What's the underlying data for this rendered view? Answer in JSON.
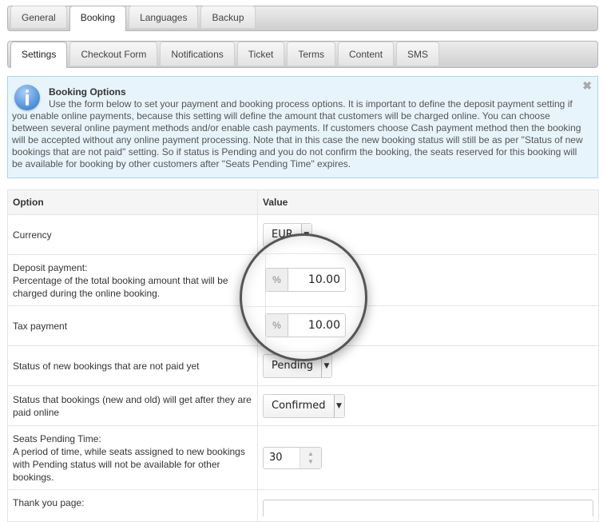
{
  "top_tabs": [
    {
      "label": "General",
      "active": false
    },
    {
      "label": "Booking",
      "active": true
    },
    {
      "label": "Languages",
      "active": false
    },
    {
      "label": "Backup",
      "active": false
    }
  ],
  "sub_tabs": [
    {
      "label": "Settings",
      "active": true
    },
    {
      "label": "Checkout Form",
      "active": false
    },
    {
      "label": "Notifications",
      "active": false
    },
    {
      "label": "Ticket",
      "active": false
    },
    {
      "label": "Terms",
      "active": false
    },
    {
      "label": "Content",
      "active": false
    },
    {
      "label": "SMS",
      "active": false
    }
  ],
  "info": {
    "icon": "info-icon",
    "title": "Booking Options",
    "body": "Use the form below to set your payment and booking process options. It is important to define the deposit payment setting if you enable online payments, because this setting will define the amount that customers will be charged online. You can choose between several online payment methods and/or enable cash payments. If customers choose Cash payment method then the booking will be accepted without any online payment processing. Note that in this case the new booking status will still be as per \"Status of new bookings that are not paid\" setting. So if status is Pending and you do not confirm the booking, the seats reserved for this booking will be available for booking by other customers after \"Seats Pending Time\" expires.",
    "close_glyph": "✖"
  },
  "table": {
    "headers": {
      "option": "Option",
      "value": "Value"
    },
    "rows": {
      "currency": {
        "label": "Currency",
        "value": "EUR"
      },
      "deposit": {
        "label": "Deposit payment:",
        "desc": "Percentage of the total booking amount that will be charged during the online booking.",
        "addon": "%",
        "value": "10.00"
      },
      "tax": {
        "label": "Tax payment",
        "addon": "%",
        "value": "10.00"
      },
      "status_unpaid": {
        "label": "Status of new bookings that are not paid yet",
        "value": "Pending"
      },
      "status_paid": {
        "label": "Status that bookings (new and old) will get after they are paid online",
        "value": "Confirmed"
      },
      "pending_time": {
        "label": "Seats Pending Time:",
        "desc": "A period of time, while seats assigned to new bookings with Pending status will not be available for other bookings.",
        "value": "30"
      },
      "thank_you": {
        "label": "Thank you page:"
      }
    }
  },
  "glyphs": {
    "dropdown": "▼",
    "spin_up": "▲",
    "spin_down": "▼"
  }
}
